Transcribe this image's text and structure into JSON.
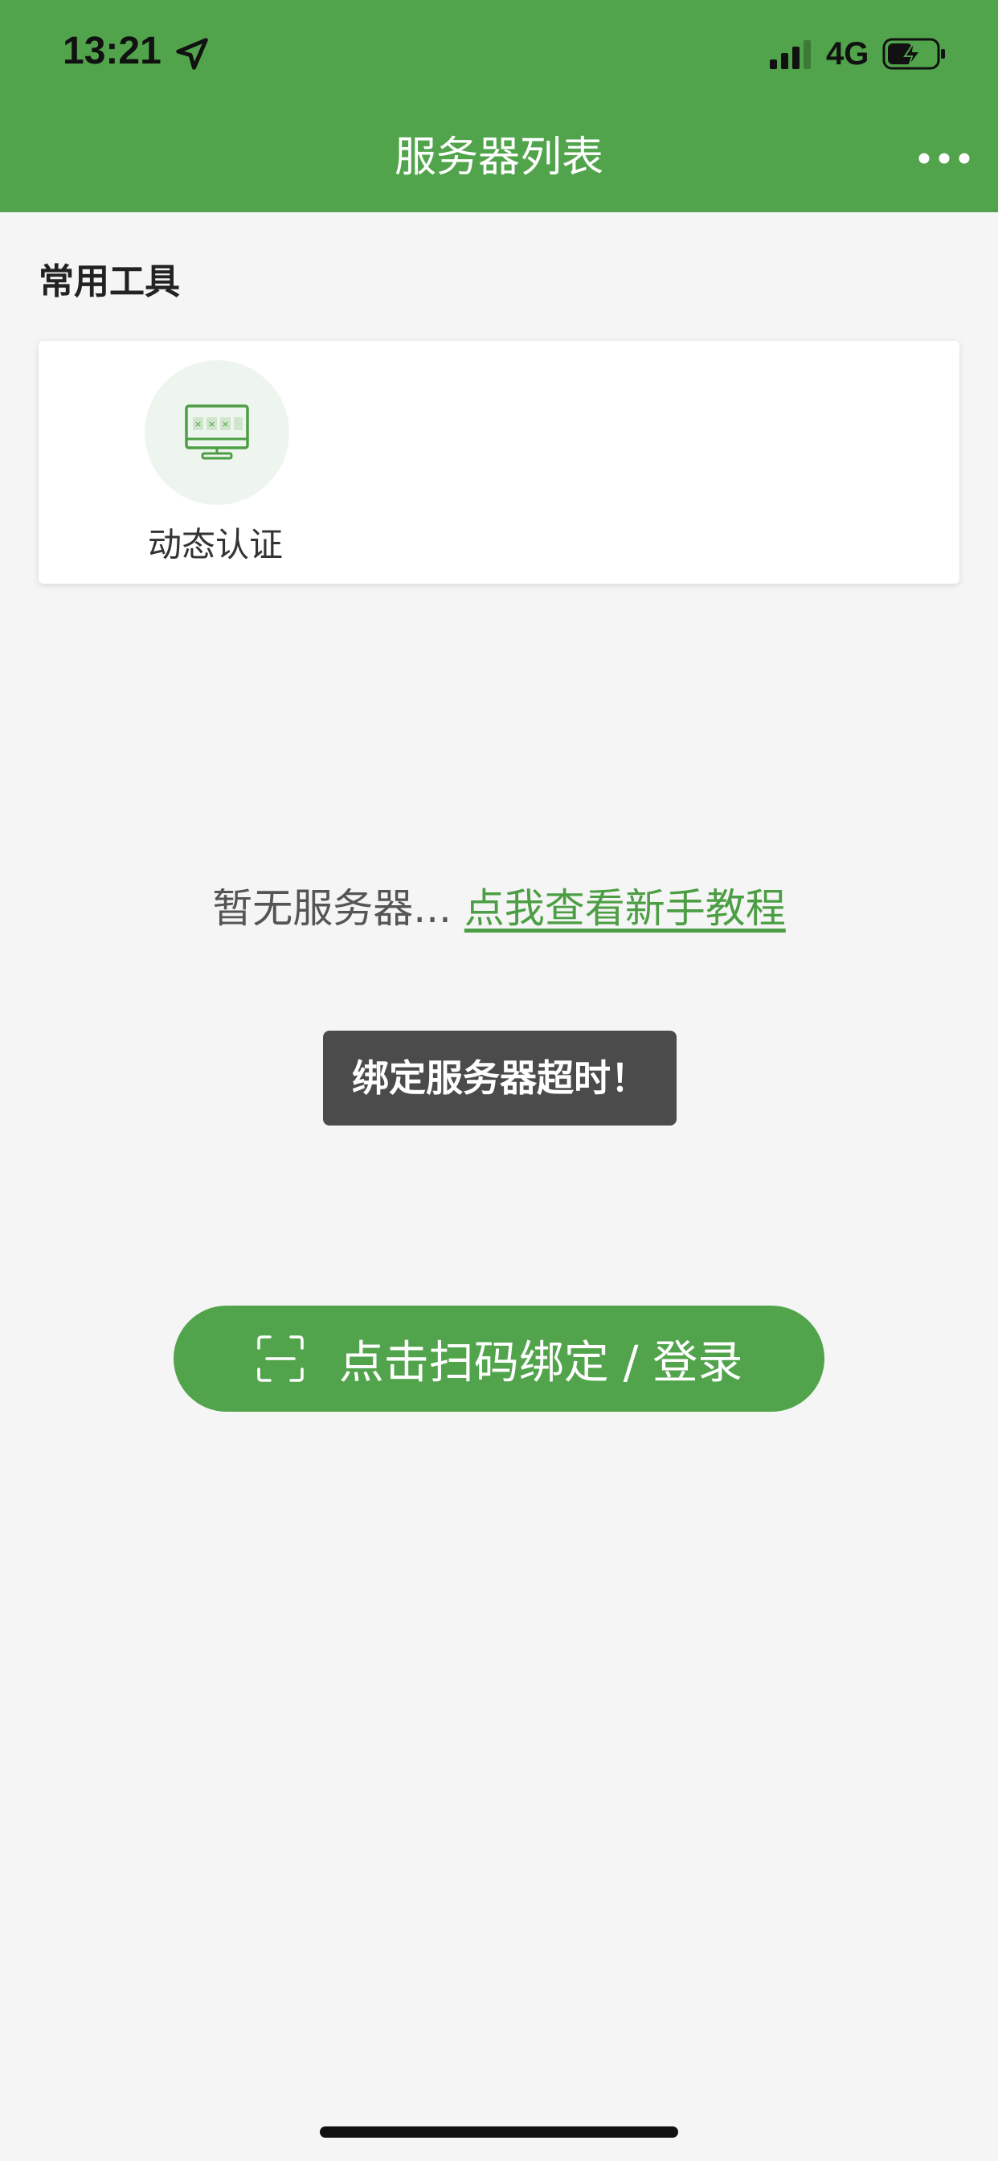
{
  "status_bar": {
    "time": "13:21",
    "network": "4G",
    "location_icon": "location-arrow-icon",
    "signal_icon": "cellular-signal-icon",
    "battery_icon": "battery-charging-icon"
  },
  "nav": {
    "title": "服务器列表",
    "more_icon": "more-dots-icon"
  },
  "tools": {
    "section_title": "常用工具",
    "items": [
      {
        "label": "动态认证",
        "icon": "monitor-password-icon"
      }
    ]
  },
  "empty_state": {
    "text": "暂无服务器... ",
    "link": "点我查看新手教程"
  },
  "toast": {
    "message": "绑定服务器超时！"
  },
  "scan_button": {
    "label": "点击扫码绑定 / 登录",
    "icon": "scan-icon"
  },
  "colors": {
    "brand": "#51a44b",
    "background": "#f5f5f5",
    "toast_bg": "#4b4b4b"
  }
}
